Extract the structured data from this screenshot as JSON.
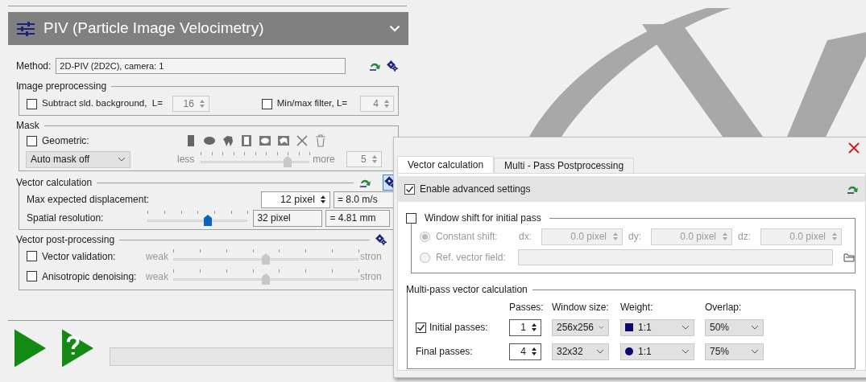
{
  "panel": {
    "title": "PIV (Particle Image Velocimetry)"
  },
  "method": {
    "label": "Method:",
    "value": "2D-PIV (2D2C), camera: 1"
  },
  "image_preprocessing": {
    "title": "Image preprocessing",
    "items": [
      {
        "label": "Subtract sld. background,  L=",
        "checked": false,
        "value": "16"
      },
      {
        "label": "Min/max filter, L=",
        "checked": false,
        "value": "4"
      }
    ]
  },
  "mask": {
    "title": "Mask",
    "geometric": {
      "label": "Geometric:",
      "checked": false
    },
    "auto_mask": "Auto mask off",
    "slider": {
      "min_label": "less",
      "max_label": "more",
      "level": 0.8,
      "value": "5"
    }
  },
  "vector_calculation": {
    "title": "Vector calculation",
    "max_displacement": {
      "label": "Max expected displacement:",
      "value": "12 pixel",
      "reading": "= 8.0 m/s"
    },
    "spatial_resolution": {
      "label": "Spatial resolution:",
      "level": 0.6,
      "value": "32 pixel",
      "reading": "= 4.81 mm"
    }
  },
  "post_processing": {
    "title": "Vector post-processing",
    "items": [
      {
        "label": "Vector validation:",
        "checked": false,
        "min_label": "weak",
        "max_label": "stron",
        "level": 0.5
      },
      {
        "label": "Anisotropic denoising:",
        "checked": false,
        "min_label": "weak",
        "max_label": "stron",
        "level": 0.5
      }
    ]
  },
  "dialog": {
    "tabs": [
      {
        "label": "Vector calculation",
        "selected": true
      },
      {
        "label": "Multi - Pass Postprocessing",
        "selected": false
      }
    ],
    "enable_advanced": {
      "label": "Enable advanced settings",
      "checked": true
    },
    "window_shift": {
      "label": "Window shift for initial pass",
      "checked": false,
      "options": [
        {
          "label": "Constant shift:",
          "selected": true
        },
        {
          "label": "Ref. vector field:",
          "selected": false
        }
      ],
      "shifts": [
        {
          "label": "dx:",
          "value": "0.0 pixel"
        },
        {
          "label": "dy:",
          "value": "0.0 pixel"
        },
        {
          "label": "dz:",
          "value": "0.0 pixel"
        }
      ]
    },
    "multi_pass": {
      "title": "Multi-pass vector calculation",
      "columns": [
        "Passes:",
        "Window size:",
        "Weight:",
        "Overlap:"
      ],
      "rows": [
        {
          "kind": "checkbox",
          "label": "Initial passes:",
          "checked": true,
          "passes": "1",
          "window_size": "256x256",
          "weight": {
            "kind": "square",
            "value": "1:1"
          },
          "overlap": "50%"
        },
        {
          "kind": "plain",
          "label": "Final passes:",
          "passes": "4",
          "window_size": "32x32",
          "weight": {
            "kind": "circle",
            "value": "1:1"
          },
          "overlap": "75%"
        }
      ]
    }
  },
  "progress": {
    "level": 0
  }
}
